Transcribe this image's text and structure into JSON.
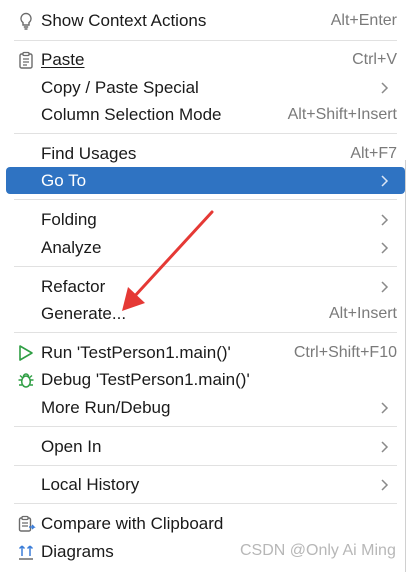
{
  "menu": {
    "show_context_actions": {
      "label": "Show Context Actions",
      "shortcut": "Alt+Enter"
    },
    "paste": {
      "label": "Paste",
      "shortcut": "Ctrl+V"
    },
    "copy_paste_special": {
      "label": "Copy / Paste Special"
    },
    "column_selection_mode": {
      "label": "Column Selection Mode",
      "shortcut": "Alt+Shift+Insert"
    },
    "find_usages": {
      "label": "Find Usages",
      "shortcut": "Alt+F7"
    },
    "go_to": {
      "label": "Go To"
    },
    "folding": {
      "label": "Folding"
    },
    "analyze": {
      "label": "Analyze"
    },
    "refactor": {
      "label": "Refactor"
    },
    "generate": {
      "label": "Generate...",
      "shortcut": "Alt+Insert"
    },
    "run": {
      "label": "Run 'TestPerson1.main()'",
      "shortcut": "Ctrl+Shift+F10"
    },
    "debug": {
      "label": "Debug 'TestPerson1.main()'"
    },
    "more_run_debug": {
      "label": "More Run/Debug"
    },
    "open_in": {
      "label": "Open In"
    },
    "local_history": {
      "label": "Local History"
    },
    "compare_with_clipboard": {
      "label": "Compare with Clipboard"
    },
    "diagrams": {
      "label": "Diagrams"
    }
  },
  "watermark": "CSDN @Only Ai Ming",
  "colors": {
    "selection": "#2f73c2",
    "run_icon": "#2f9e44",
    "debug_icon": "#2f9e44",
    "arrow": "#e53935"
  },
  "icons": [
    "lightbulb-icon",
    "clipboard-icon",
    "run-triangle-icon",
    "debug-bug-icon",
    "compare-clipboard-icon",
    "diagrams-icon",
    "chevron-right-icon"
  ]
}
